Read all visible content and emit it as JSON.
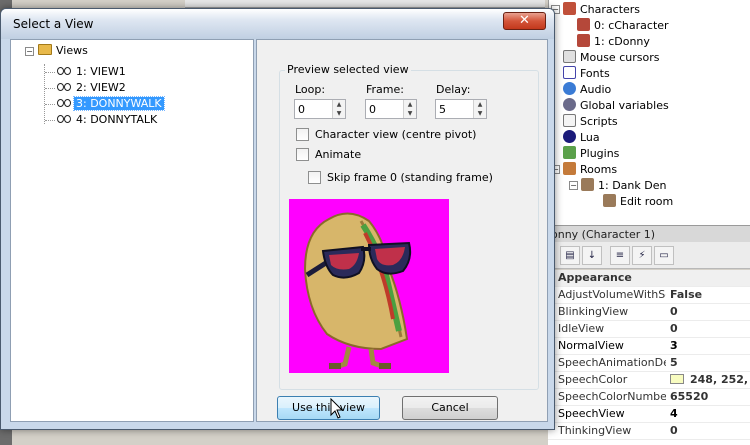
{
  "dialog": {
    "title": "Select a View",
    "close_glyph": "✕"
  },
  "views_tree": {
    "root_label": "Views",
    "items": [
      {
        "label": "1: VIEW1",
        "selected": false
      },
      {
        "label": "2: VIEW2",
        "selected": false
      },
      {
        "label": "3: DONNYWALK",
        "selected": true
      },
      {
        "label": "4: DONNYTALK",
        "selected": false
      }
    ]
  },
  "preview": {
    "group_title": "Preview selected view",
    "loop_label": "Loop:",
    "loop_value": "0",
    "frame_label": "Frame:",
    "frame_value": "0",
    "delay_label": "Delay:",
    "delay_value": "5",
    "character_view_label": "Character view (centre pivot)",
    "animate_label": "Animate",
    "skip_frame_label": "Skip frame 0 (standing frame)",
    "background_color": "#ff00ff"
  },
  "buttons": {
    "use_label": "Use this view",
    "cancel_label": "Cancel"
  },
  "project_tree": {
    "items": [
      {
        "label": "Characters",
        "icon": "characters-icon"
      },
      {
        "label": "0: cCharacter",
        "icon": "character-icon"
      },
      {
        "label": "1: cDonny",
        "icon": "character-icon"
      },
      {
        "label": "Mouse cursors",
        "icon": "cursor-icon"
      },
      {
        "label": "Fonts",
        "icon": "font-icon"
      },
      {
        "label": "Audio",
        "icon": "audio-icon"
      },
      {
        "label": "Global variables",
        "icon": "globe-icon"
      },
      {
        "label": "Scripts",
        "icon": "script-icon"
      },
      {
        "label": "Lua",
        "icon": "lua-icon"
      },
      {
        "label": "Plugins",
        "icon": "plugin-icon"
      },
      {
        "label": "Rooms",
        "icon": "rooms-icon"
      },
      {
        "label": "1: Dank Den",
        "icon": "room-icon"
      },
      {
        "label": "Edit room",
        "icon": "edit-room-icon"
      }
    ]
  },
  "properties": {
    "header": "onny (Character 1)",
    "category": "Appearance",
    "rows": [
      {
        "key": "AdjustVolumeWithScal",
        "value": "False"
      },
      {
        "key": "BlinkingView",
        "value": "0"
      },
      {
        "key": "IdleView",
        "value": "0"
      },
      {
        "key": "NormalView",
        "value": "3"
      },
      {
        "key": "SpeechAnimationDelay",
        "value": "5"
      },
      {
        "key": "SpeechColor",
        "value": "248, 252,"
      },
      {
        "key": "SpeechColorNumber",
        "value": "65520"
      },
      {
        "key": "SpeechView",
        "value": "4"
      },
      {
        "key": "ThinkingView",
        "value": "0"
      }
    ]
  }
}
